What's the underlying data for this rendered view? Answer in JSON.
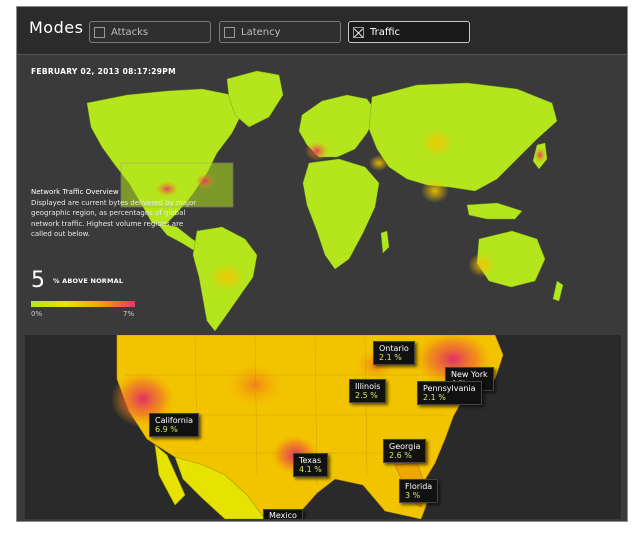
{
  "header": {
    "title": "Modes",
    "modes": [
      {
        "label": "Attacks",
        "checked": false
      },
      {
        "label": "Latency",
        "checked": false
      },
      {
        "label": "Traffic",
        "checked": true
      }
    ]
  },
  "world": {
    "timestamp": "FEBRUARY 02, 2013 08:17:29PM",
    "overview_title": "Network Traffic Overview",
    "overview_text": "Displayed are current bytes delivered by major geographic region, as percentages of global network traffic. Highest volume regions are called out below.",
    "above_value": "5",
    "above_label": "% ABOVE NORMAL",
    "scale_min": "0%",
    "scale_max": "7%"
  },
  "us": {
    "callouts": [
      {
        "name": "Ontario",
        "value": "2.1 %"
      },
      {
        "name": "New York",
        "value": "4 %"
      },
      {
        "name": "Pennsylvania",
        "value": "2.1 %"
      },
      {
        "name": "Illinois",
        "value": "2.5 %"
      },
      {
        "name": "California",
        "value": "6.9 %"
      },
      {
        "name": "Georgia",
        "value": "2.6 %"
      },
      {
        "name": "Texas",
        "value": "4.1 %"
      },
      {
        "name": "Florida",
        "value": "3 %"
      },
      {
        "name": "Mexico",
        "value": ""
      }
    ]
  },
  "colors": {
    "land": "#b5e61d",
    "hot": "#e8336b",
    "warm": "#f5a300",
    "panel": "#3a3a3a"
  }
}
